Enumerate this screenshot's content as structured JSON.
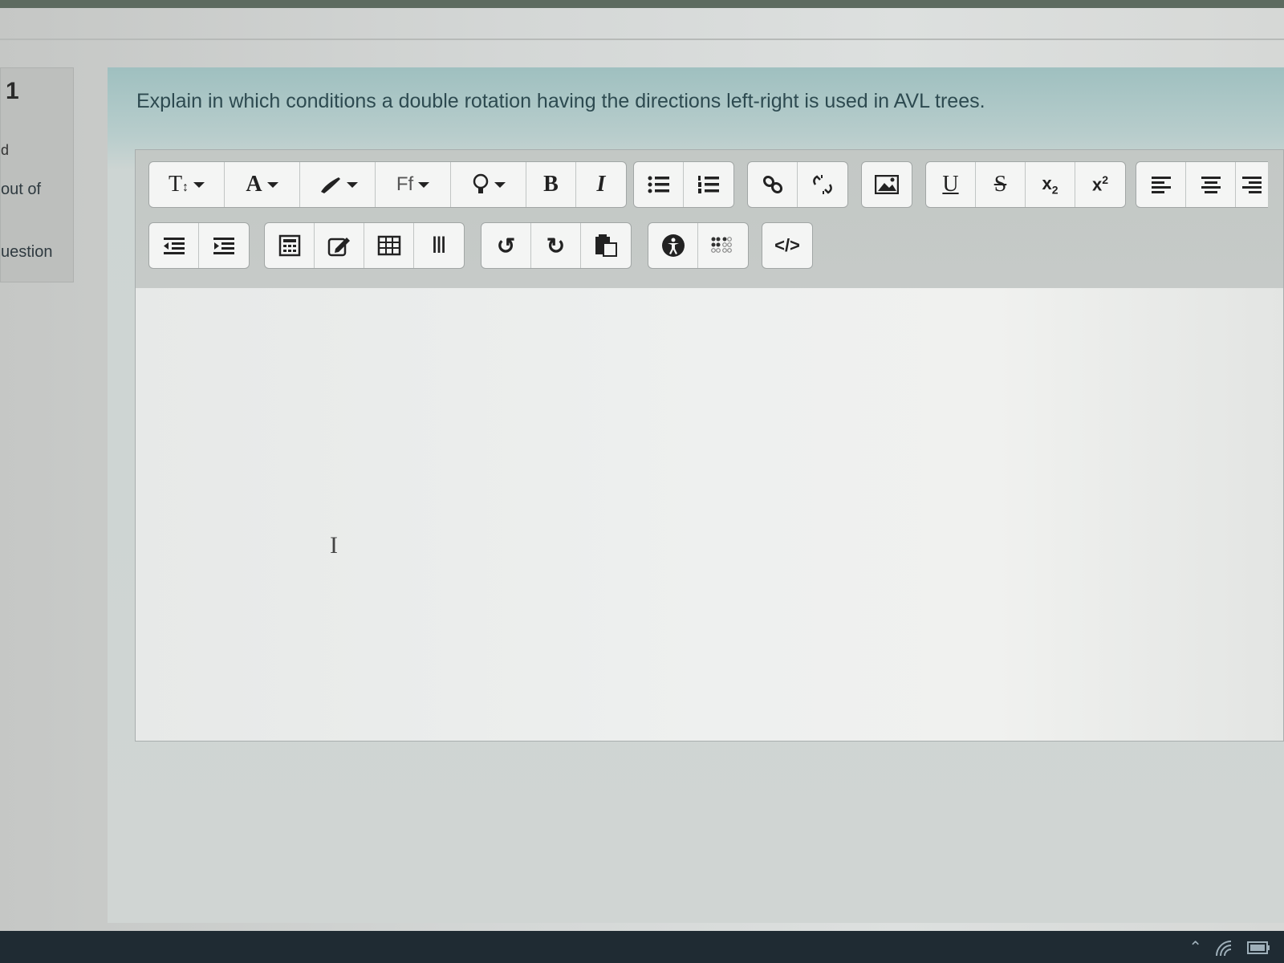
{
  "question_info": {
    "number": "1",
    "state": "d",
    "mark": "out of",
    "flag": "uestion"
  },
  "question": {
    "text": "Explain in which conditions a double rotation having the directions left-right  is used in AVL trees."
  },
  "toolbar": {
    "row1": [
      {
        "name": "paragraph-styles-icon",
        "glyph": "T↕",
        "dropdown": true
      },
      {
        "name": "font-color-icon",
        "glyph": "A",
        "dropdown": true
      },
      {
        "name": "background-color-icon",
        "glyph": "✎",
        "dropdown": true
      },
      {
        "name": "font-family-icon",
        "glyph": "Ff",
        "dropdown": true
      },
      {
        "name": "lightbulb-icon",
        "glyph": "♀",
        "dropdown": true
      },
      {
        "name": "bold-icon",
        "glyph": "B"
      },
      {
        "name": "italic-icon",
        "glyph": "I"
      },
      {
        "name": "unordered-list-icon",
        "glyph": "☰"
      },
      {
        "name": "ordered-list-icon",
        "glyph": "≡"
      },
      {
        "name": "link-icon",
        "glyph": "⚭"
      },
      {
        "name": "unlink-icon",
        "glyph": "⚮"
      },
      {
        "name": "image-icon",
        "glyph": "▣"
      },
      {
        "name": "underline-icon",
        "glyph": "U"
      },
      {
        "name": "strikethrough-icon",
        "glyph": "S"
      },
      {
        "name": "subscript-icon",
        "glyph": "x₂"
      },
      {
        "name": "superscript-icon",
        "glyph": "x²"
      },
      {
        "name": "align-left-icon",
        "glyph": "≡"
      },
      {
        "name": "align-center-icon",
        "glyph": "≣"
      },
      {
        "name": "align-right-icon",
        "glyph": "≡"
      }
    ],
    "row2": [
      {
        "name": "outdent-icon",
        "glyph": "⇤"
      },
      {
        "name": "indent-icon",
        "glyph": "⇥"
      },
      {
        "name": "equation-editor-icon",
        "glyph": "▦"
      },
      {
        "name": "edit-icon",
        "glyph": "✎"
      },
      {
        "name": "table-icon",
        "glyph": "▦"
      },
      {
        "name": "text-cursor-icon",
        "glyph": "I"
      },
      {
        "name": "undo-icon",
        "glyph": "↺"
      },
      {
        "name": "redo-icon",
        "glyph": "↻"
      },
      {
        "name": "paste-icon",
        "glyph": "⎘"
      },
      {
        "name": "accessibility-checker-icon",
        "glyph": "♿"
      },
      {
        "name": "screen-reader-helper-icon",
        "glyph": "∷"
      },
      {
        "name": "html-source-icon",
        "glyph": "</>"
      }
    ]
  },
  "editor": {
    "content": ""
  }
}
